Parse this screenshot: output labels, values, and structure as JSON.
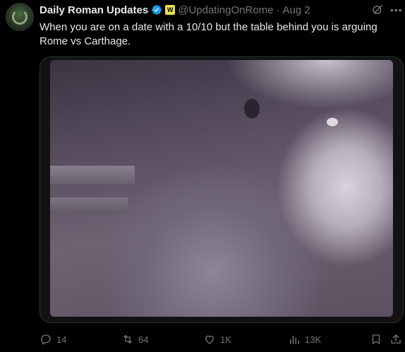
{
  "author": {
    "name": "Daily Roman Updates",
    "handle": "@UpdatingOnRome",
    "separator": "·",
    "date": "Aug 2",
    "affiliate_badge": "W"
  },
  "tweet_text": "When you are on a date with a 10/10 but the table behind you is arguing Rome vs Carthage.",
  "icons": {
    "verified": "verified-badge-icon",
    "grok": "grok-icon",
    "more": "more-options-icon"
  },
  "actions": {
    "replies": "14",
    "reposts": "64",
    "likes": "1K",
    "views": "13K"
  },
  "colors": {
    "background": "#000000",
    "text": "#e7e9ea",
    "muted": "#71767b",
    "verified": "#1d9bf0",
    "affiliate": "#e7e34a",
    "border": "#2f3336"
  }
}
